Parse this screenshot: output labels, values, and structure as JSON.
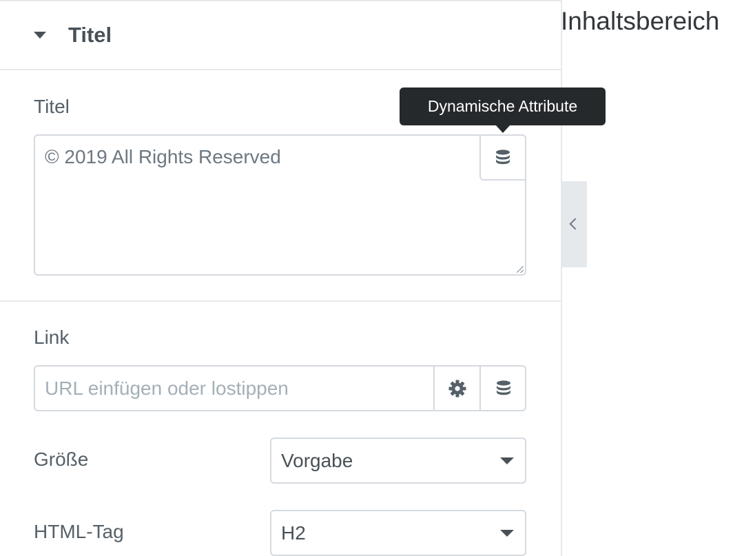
{
  "panel": {
    "section_title": "Titel",
    "title_field": {
      "label": "Titel",
      "value": "© 2019 All Rights Reserved",
      "dynamic_icon": "database-icon"
    },
    "tooltip": "Dynamische Attribute",
    "link_field": {
      "label": "Link",
      "placeholder": "URL einfügen oder lostippen",
      "options_icon": "gear-icon",
      "dynamic_icon": "database-icon"
    },
    "size_field": {
      "label": "Größe",
      "selected": "Vorgabe"
    },
    "html_tag_field": {
      "label": "HTML-Tag",
      "selected": "H2"
    }
  },
  "canvas": {
    "title": "Inhaltsbereich",
    "collapse_icon": "chevron-left-icon"
  },
  "colors": {
    "text": "#495157",
    "border": "#d5dadf",
    "divider": "#e6e9ec",
    "tooltip_bg": "#26292c"
  }
}
